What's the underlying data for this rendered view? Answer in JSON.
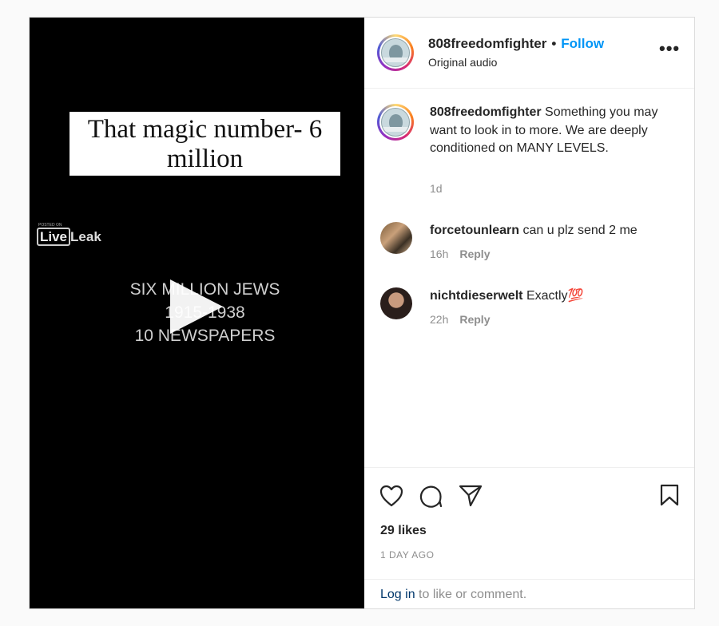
{
  "video": {
    "overlay_caption": "That magic number- 6 million",
    "watermark_small": "POSTED ON",
    "watermark_live": "Live",
    "watermark_leak": "Leak",
    "lines": [
      "SIX MILLION JEWS",
      "1915-1938",
      "10 NEWSPAPERS"
    ]
  },
  "header": {
    "username": "808freedomfighter",
    "separator": "•",
    "follow_label": "Follow",
    "audio": "Original audio",
    "more_label": "•••"
  },
  "caption": {
    "username": "808freedomfighter",
    "text": "Something you may want to look in to more. We are deeply conditioned on MANY LEVELS.",
    "time": "1d"
  },
  "comments": [
    {
      "username": "forcetounlearn",
      "text": "can u plz send 2 me",
      "time": "16h",
      "reply": "Reply"
    },
    {
      "username": "nichtdieserwelt",
      "text": "Exactly💯",
      "time": "22h",
      "reply": "Reply"
    }
  ],
  "actions": {
    "likes": "29 likes",
    "timestamp": "1 DAY AGO"
  },
  "login": {
    "link": "Log in",
    "text": " to like or comment."
  }
}
